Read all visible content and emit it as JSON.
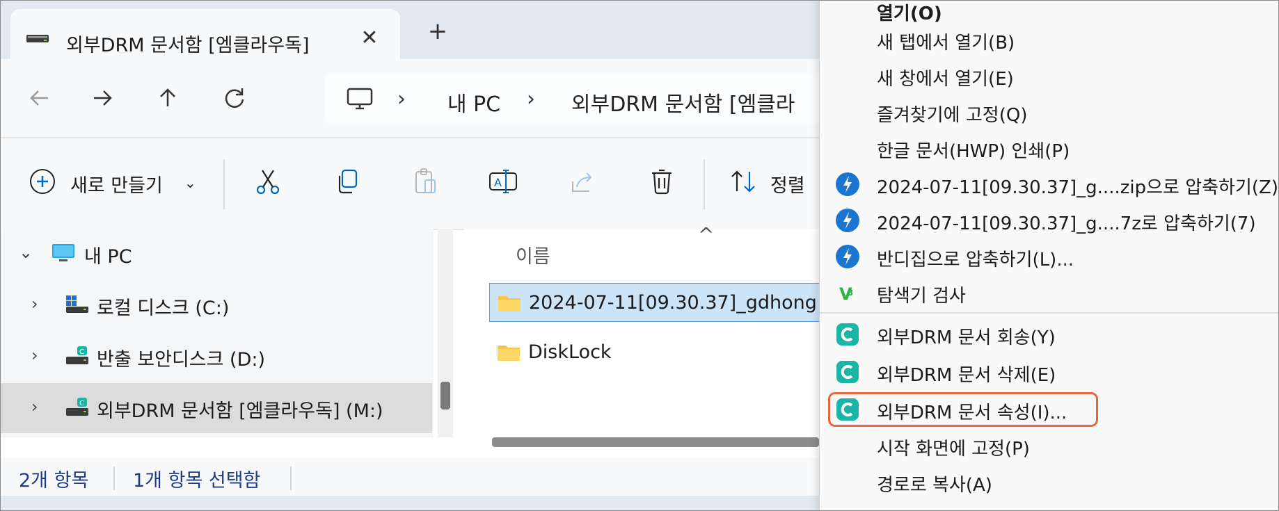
{
  "tab": {
    "title": "외부DRM 문서함 [엠클라우독]",
    "close": "✕",
    "new_tab": "+"
  },
  "nav": {
    "back_icon": "arrow-left-icon",
    "forward_icon": "arrow-right-icon",
    "up_icon": "arrow-up-icon",
    "refresh_icon": "refresh-icon",
    "breadcrumb": [
      "내 PC",
      "외부DRM 문서함 [엠클라"
    ],
    "separator": "›"
  },
  "toolbar": {
    "new_label": "새로 만들기",
    "sort_label": "정렬"
  },
  "tree": {
    "items": [
      {
        "expander": "⌄",
        "label": "내 PC"
      },
      {
        "expander": "›",
        "label": "로컬 디스크 (C:)"
      },
      {
        "expander": "›",
        "label": "반출 보안디스크 (D:)"
      },
      {
        "expander": "›",
        "label": "외부DRM 문서함 [엠클라우독] (M:)"
      }
    ]
  },
  "files": {
    "column_name": "이름",
    "sort_arrow": "^",
    "rows": [
      {
        "name": "2024-07-11[09.30.37]_gdhong"
      },
      {
        "name": "DiskLock"
      }
    ]
  },
  "status": {
    "count": "2개 항목",
    "selected": "1개 항목 선택함"
  },
  "menu": {
    "items": [
      {
        "label": "열기(O)"
      },
      {
        "label": "새 탭에서 열기(B)"
      },
      {
        "label": "새 창에서 열기(E)"
      },
      {
        "label": "즐겨찾기에 고정(Q)"
      },
      {
        "label": "한글 문서(HWP) 인쇄(P)"
      },
      {
        "label": "2024-07-11[09.30.37]_g....zip으로 압축하기(Z)"
      },
      {
        "label": "2024-07-11[09.30.37]_g....7z로 압축하기(7)"
      },
      {
        "label": "반디집으로 압축하기(L)..."
      },
      {
        "label": "탐색기 검사"
      },
      {
        "label": "외부DRM 문서 회송(Y)"
      },
      {
        "label": "외부DRM 문서 삭제(E)"
      },
      {
        "label": "외부DRM 문서 속성(I)..."
      },
      {
        "label": "시작 화면에 고정(P)"
      },
      {
        "label": "경로로 복사(A)"
      }
    ]
  },
  "colors": {
    "accent": "#0067c0",
    "highlight": "#e8683c",
    "drm_green": "#1bb5a6"
  }
}
